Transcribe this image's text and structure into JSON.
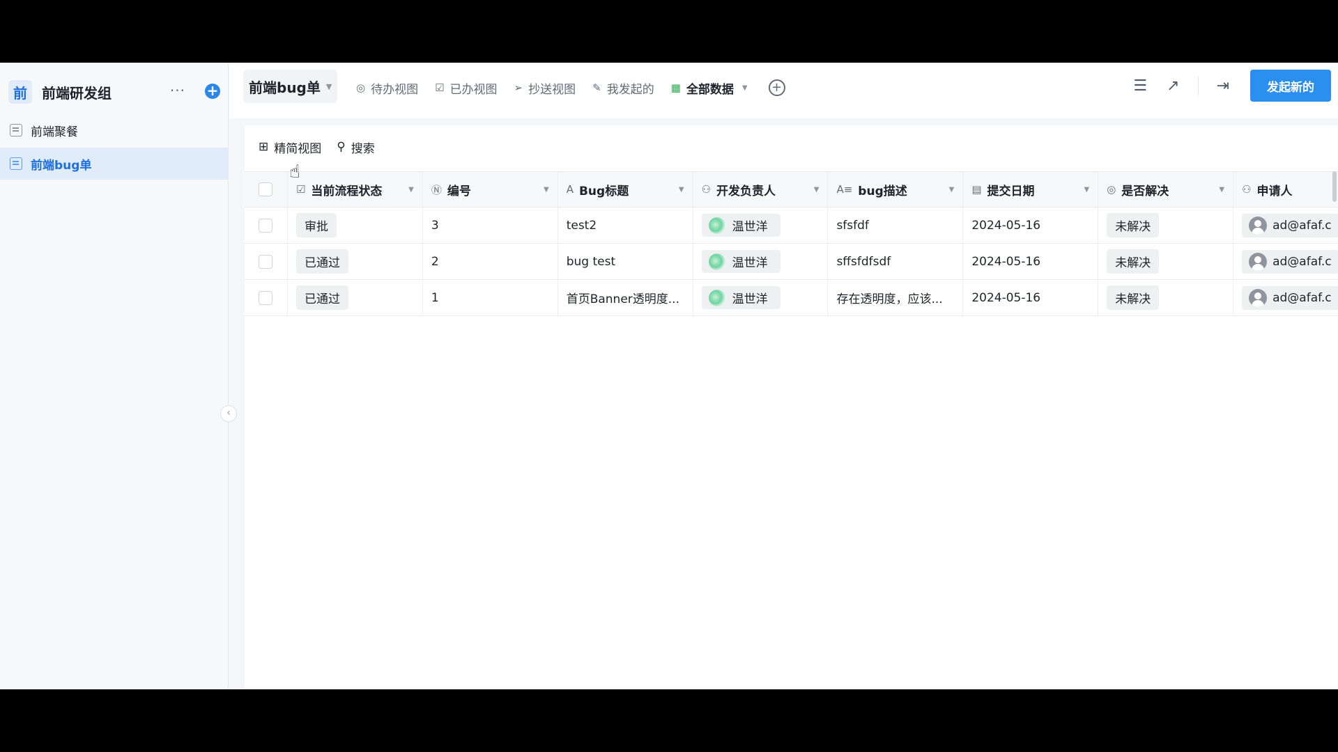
{
  "sidebar": {
    "group_avatar": "前",
    "group_name": "前端研发组",
    "more": "···",
    "add": "+",
    "items": [
      {
        "label": "前端聚餐"
      },
      {
        "label": "前端bug单"
      }
    ],
    "collapse": "‹"
  },
  "topbar": {
    "form_title": "前端bug单",
    "tabs": [
      {
        "label": "待办视图",
        "icon": "check-circle-icon"
      },
      {
        "label": "已办视图",
        "icon": "check-square-icon"
      },
      {
        "label": "抄送视图",
        "icon": "send-icon"
      },
      {
        "label": "我发起的",
        "icon": "edit-doc-icon"
      },
      {
        "label": "全部数据",
        "icon": "table-icon"
      }
    ],
    "add_view": "+",
    "primary_button": "发起新的"
  },
  "toolbar": {
    "view_mode": "精简视图",
    "search": "搜索"
  },
  "table": {
    "columns": [
      "当前流程状态",
      "编号",
      "Bug标题",
      "开发负责人",
      "bug描述",
      "提交日期",
      "是否解决",
      "申请人"
    ],
    "rows": [
      {
        "status": "审批",
        "id": "3",
        "title": "test2",
        "owner": "温世洋",
        "desc": "sfsfdf",
        "date": "2024-05-16",
        "resolved": "未解决",
        "applicant": "ad@afaf.c"
      },
      {
        "status": "已通过",
        "id": "2",
        "title": "bug test",
        "owner": "温世洋",
        "desc": "sffsfdfsdf",
        "date": "2024-05-16",
        "resolved": "未解决",
        "applicant": "ad@afaf.c"
      },
      {
        "status": "已通过",
        "id": "1",
        "title": "首页Banner透明度...",
        "owner": "温世洋",
        "desc": "存在透明度，应该...",
        "date": "2024-05-16",
        "resolved": "未解决",
        "applicant": "ad@afaf.c"
      }
    ]
  },
  "colors": {
    "accent": "#2b8ff0",
    "active_bg": "#e1ecfb",
    "active_text": "#1f6fe0",
    "table_icon": "#34a853"
  }
}
